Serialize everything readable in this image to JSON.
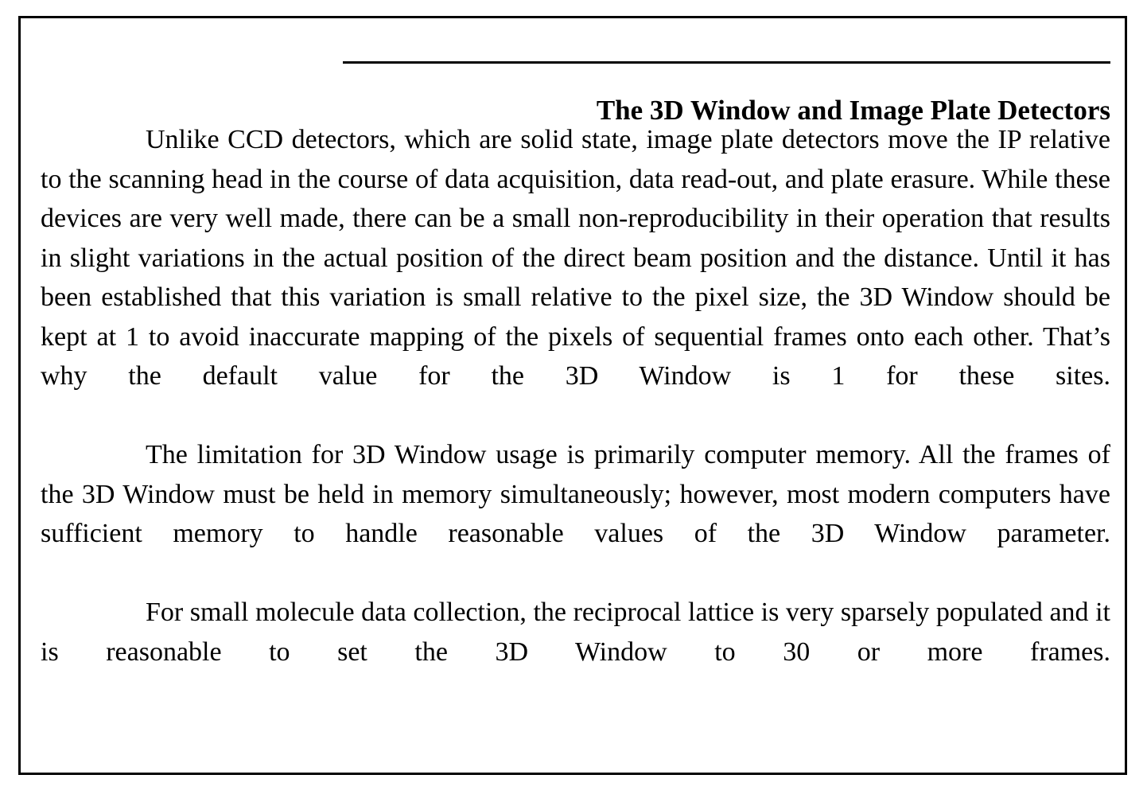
{
  "document": {
    "heading": "The 3D Window and Image Plate Detectors",
    "paragraphs": [
      "Unlike CCD detectors, which are solid state, image plate detectors move the IP relative to the scanning head in the course of data acquisition, data read-out, and plate erasure. While these devices are very well made, there can be a small non-reproducibility in their operation that results in slight variations in the actual position of the direct beam position and the distance. Until it has been established that this variation is small relative to the pixel size, the 3D Window should be kept at 1 to avoid inaccurate mapping of the pixels of sequential frames onto each other. That’s why the default value for the 3D Window is 1 for these sites.",
      "The limitation for 3D Window usage is primarily computer memory. All the frames of the 3D Window must be held in memory simultaneously; however, most modern computers have sufficient memory to handle reasonable values of the 3D Window parameter.",
      "For small molecule data collection, the reciprocal lattice is very sparsely populated and it is reasonable to set the 3D Window to 30 or more frames."
    ]
  },
  "colors": {
    "text": "#000000",
    "background": "#ffffff",
    "border": "#000000"
  }
}
